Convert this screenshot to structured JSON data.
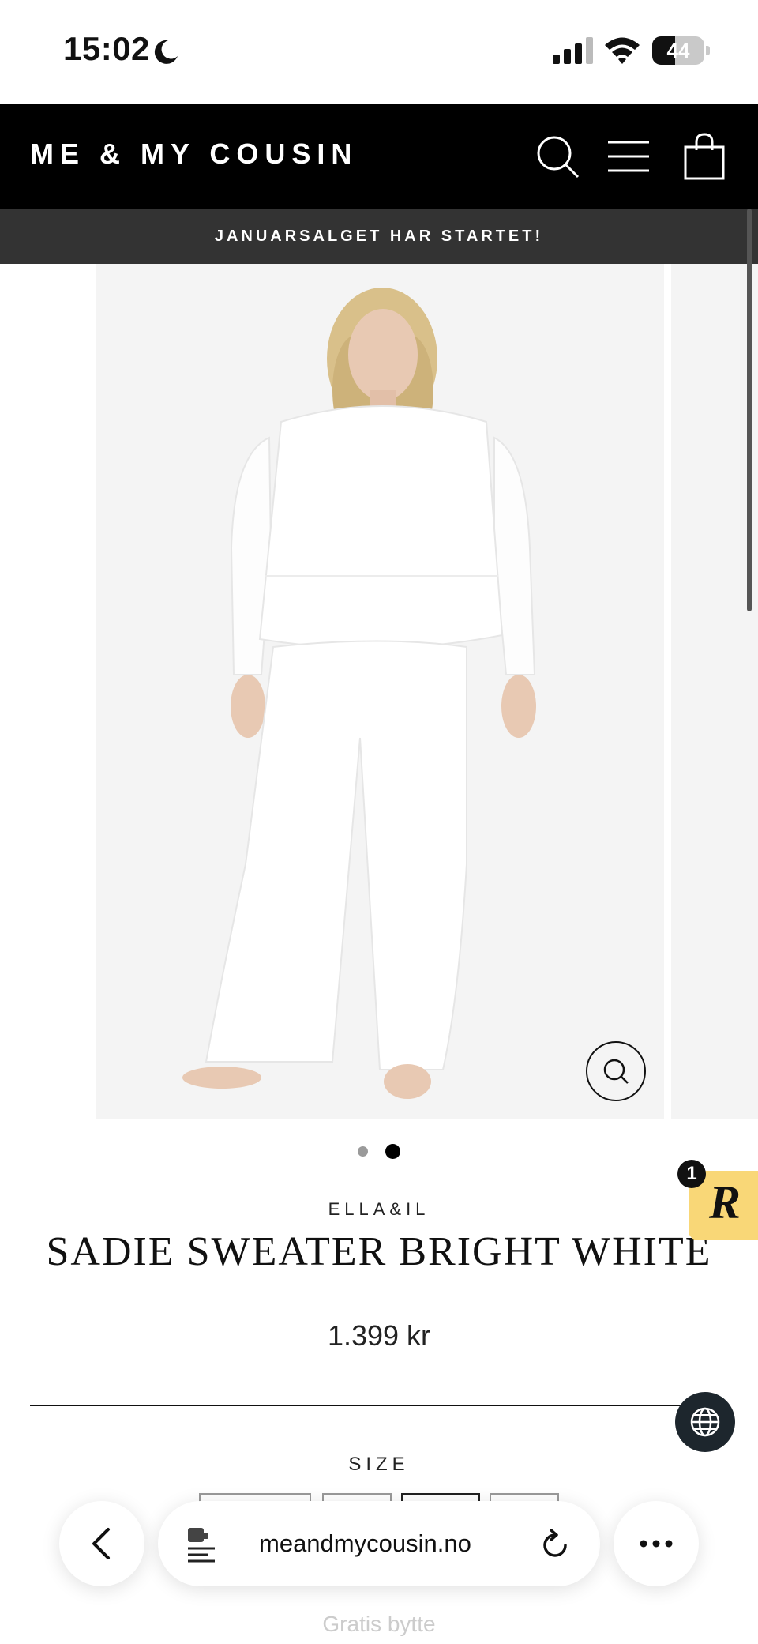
{
  "status_bar": {
    "time": "15:02",
    "battery_level": "44",
    "battery_fraction": 0.44
  },
  "header": {
    "logo": "ME & MY COUSIN"
  },
  "announcement": "JANUARSALGET HAR STARTET!",
  "gallery": {
    "slide_count": 2,
    "active_slide": 2
  },
  "product": {
    "brand": "ELLA&IL",
    "title": "SADIE SWEATER BRIGHT WHITE",
    "price": "1.399 kr",
    "size_label": "SIZE"
  },
  "rewards_widget": {
    "badge_count": "1",
    "letter": "R",
    "color": "#f9d777"
  },
  "browser": {
    "url": "meandmycousin.no"
  },
  "footer_hint": "Gratis bytte",
  "icons": [
    "moon-icon",
    "signal-icon",
    "wifi-icon",
    "battery-icon",
    "search-icon",
    "menu-icon",
    "cart-icon",
    "zoom-icon",
    "globe-icon",
    "back-icon",
    "extension-icon",
    "reload-icon",
    "more-icon"
  ]
}
